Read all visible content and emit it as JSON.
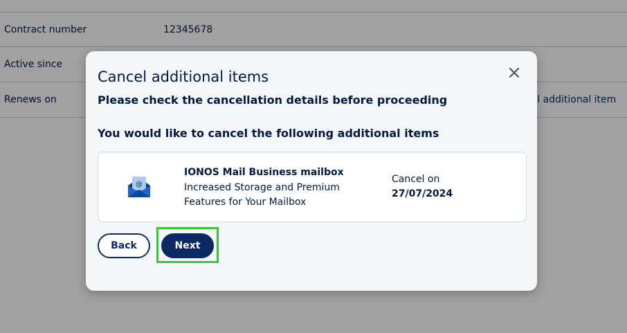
{
  "background": {
    "rows": [
      {
        "label": "Contract number",
        "value": "12345678",
        "link": ""
      },
      {
        "label": "Active since",
        "value": "",
        "link": ""
      },
      {
        "label": "Renews on",
        "value": "",
        "link": "cel additional item"
      }
    ]
  },
  "modal": {
    "title": "Cancel additional items",
    "close_icon": "close-icon",
    "subtitle": "Please check the cancellation details before proceeding",
    "section_heading": "You would like to cancel the following additional items",
    "item": {
      "icon": "mail-envelope-icon",
      "name": "IONOS Mail Business mailbox",
      "description": "Increased Storage and Premium Features for Your Mailbox",
      "cancel_label": "Cancel on",
      "cancel_date": "27/07/2024"
    },
    "buttons": {
      "back_label": "Back",
      "next_label": "Next"
    }
  },
  "colors": {
    "primary": "#0b2a63",
    "highlight": "#3cc43c",
    "modal_bg": "#f4f7fa"
  }
}
